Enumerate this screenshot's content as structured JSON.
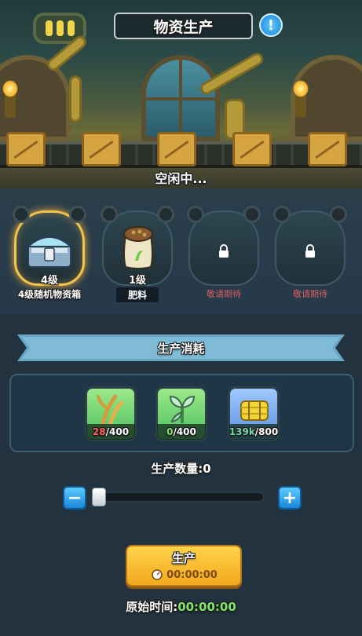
{
  "header": {
    "title": "物资生产",
    "info_icon": "exclamation-icon",
    "status": "空闲中..."
  },
  "slots": [
    {
      "level": "4级",
      "name": "4级随机物资箱",
      "icon": "chest-icon",
      "selected": true
    },
    {
      "level": "1级",
      "name": "肥料",
      "icon": "fertilizer-bag-icon",
      "selected": false
    },
    {
      "name": "敬请期待",
      "icon": "lock-icon",
      "locked": true
    },
    {
      "name": "敬请期待",
      "icon": "lock-icon",
      "locked": true
    }
  ],
  "consumption": {
    "title": "生产消耗",
    "resources": [
      {
        "icon": "wheat-stalk-icon",
        "have": "28",
        "need": "/400",
        "status_color": "#ff6060"
      },
      {
        "icon": "herb-leaf-icon",
        "have": "0",
        "need": "/400",
        "status_color": "#7fe86b"
      },
      {
        "icon": "hay-bale-icon",
        "have": "139k",
        "need": "/800",
        "status_color": "#70d4ae"
      }
    ]
  },
  "quantity": {
    "label": "生产数量:0",
    "value": 0,
    "minus": "−",
    "plus": "+"
  },
  "produce_button": {
    "label": "生产",
    "time": "00:00:00"
  },
  "original_time": {
    "label": "原始时间:",
    "value": "00:00:00"
  },
  "colors": {
    "gold": "#f4c54c",
    "accent_blue": "#1a87d8",
    "time_green": "#7fe86b",
    "pending_red": "#d7605f"
  }
}
